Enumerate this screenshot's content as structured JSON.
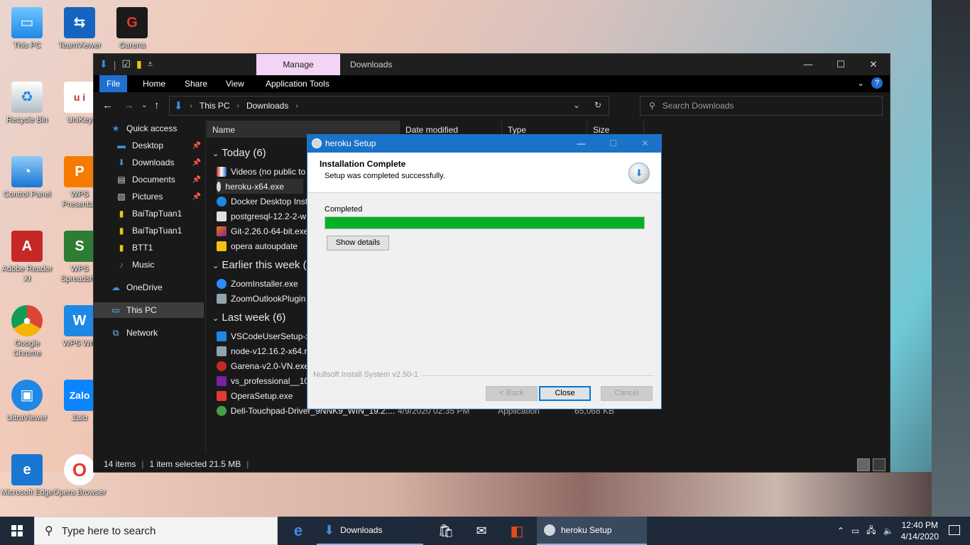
{
  "desktop": {
    "icons": [
      {
        "label": "This PC"
      },
      {
        "label": "TeamViewer"
      },
      {
        "label": "Garena"
      },
      {
        "label": "Recycle Bin"
      },
      {
        "label": "UniKey"
      },
      {
        "label": "Control Panel"
      },
      {
        "label": "WPS Presentati"
      },
      {
        "label": "Adobe Reader XI"
      },
      {
        "label": "WPS Spreadshe"
      },
      {
        "label": "Google Chrome"
      },
      {
        "label": "WPS Writ"
      },
      {
        "label": "UltraViewer"
      },
      {
        "label": "Zalo"
      },
      {
        "label": "Microsoft Edge"
      },
      {
        "label": "Opera Browser"
      }
    ]
  },
  "explorer": {
    "manage_tab": "Manage",
    "title": "Downloads",
    "ribbon_tabs": [
      "File",
      "Home",
      "Share",
      "View",
      "Application Tools"
    ],
    "breadcrumb": [
      "This PC",
      "Downloads"
    ],
    "search_placeholder": "Search Downloads",
    "nav_items": [
      {
        "label": "Quick access",
        "pinned": false
      },
      {
        "label": "Desktop",
        "pinned": true
      },
      {
        "label": "Downloads",
        "pinned": true
      },
      {
        "label": "Documents",
        "pinned": true
      },
      {
        "label": "Pictures",
        "pinned": true
      },
      {
        "label": "BaiTapTuan1",
        "pinned": false
      },
      {
        "label": "BaiTapTuan1",
        "pinned": false
      },
      {
        "label": "BTT1",
        "pinned": false
      },
      {
        "label": "Music",
        "pinned": false
      },
      {
        "label": "OneDrive",
        "pinned": false
      },
      {
        "label": "This PC",
        "pinned": false
      },
      {
        "label": "Network",
        "pinned": false
      }
    ],
    "columns": [
      "Name",
      "Date modified",
      "Type",
      "Size"
    ],
    "groups": [
      {
        "header": "Today (6)",
        "files": [
          "Videos (no public to",
          "heroku-x64.exe",
          "Docker Desktop Inst",
          "postgresql-12.2-2-w",
          "Git-2.26.0-64-bit.exe",
          "opera autoupdate"
        ]
      },
      {
        "header": "Earlier this week (2",
        "files": [
          "ZoomInstaller.exe",
          "ZoomOutlookPlugin"
        ]
      },
      {
        "header": "Last week (6)",
        "files": [
          "VSCodeUserSetup-x",
          "node-v12.16.2-x64.r",
          "Garena-v2.0-VN.exe",
          "vs_professional__10",
          "OperaSetup.exe"
        ]
      }
    ],
    "last_file": {
      "name": "Dell-Touchpad-Driver_9NNK9_WIN_19.2....",
      "date": "4/9/2020 02:35 PM",
      "type": "Application",
      "size": "65,068 KB"
    },
    "status": {
      "items": "14 items",
      "selected": "1 item selected  21.5 MB"
    }
  },
  "dialog": {
    "title": "heroku Setup",
    "header_title": "Installation Complete",
    "header_subtitle": "Setup was completed successfully.",
    "progress_label": "Completed",
    "progress": 1.0,
    "show_details": "Show details",
    "branding": "Nullsoft Install System v2.50-1",
    "back": "< Back",
    "close": "Close",
    "cancel": "Cancel"
  },
  "taskbar": {
    "search_placeholder": "Type here to search",
    "apps": [
      {
        "label": "Downloads"
      },
      {
        "label": "heroku Setup"
      }
    ],
    "time": "12:40 PM",
    "date": "4/14/2020"
  },
  "colors": {
    "accent": "#1a73c8",
    "progress": "#06b025",
    "manage_tab": "#f2d5f5"
  }
}
